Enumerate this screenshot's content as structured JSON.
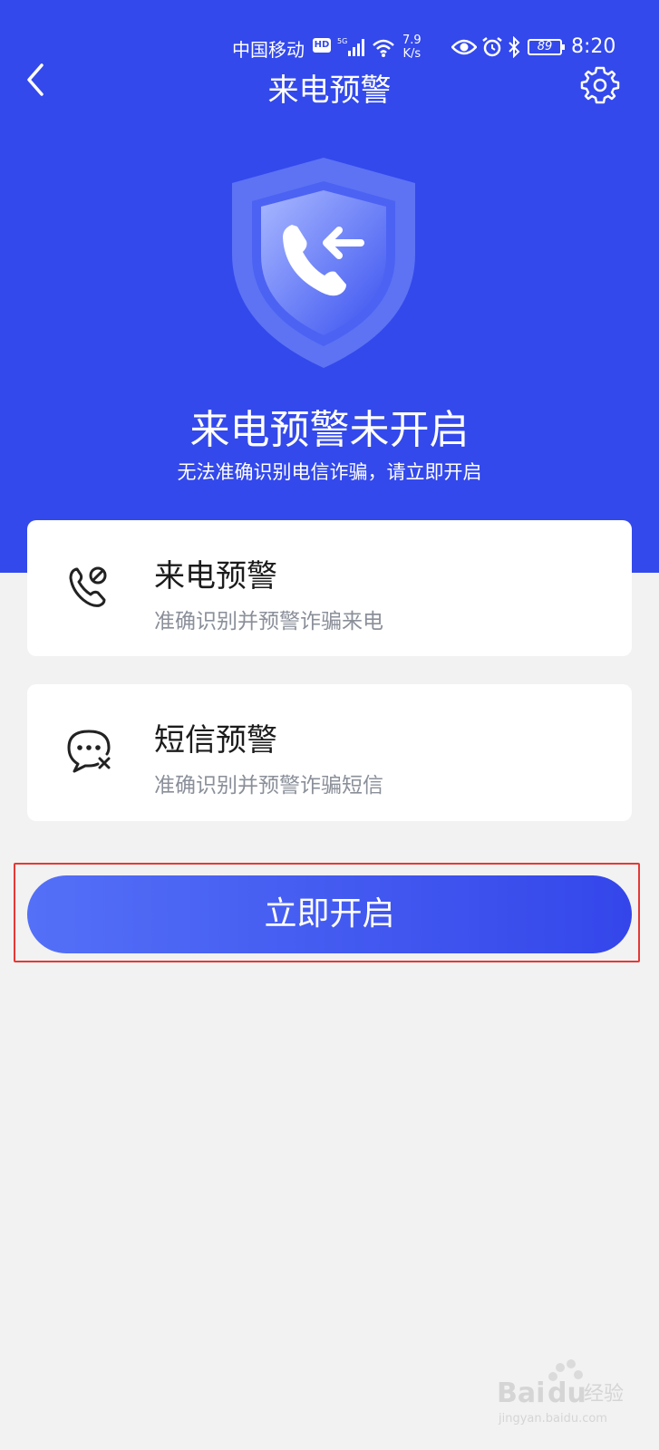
{
  "status_bar": {
    "carrier": "中国移动",
    "hd_badge": "HD",
    "speed_value": "7.9",
    "speed_unit": "K/s",
    "battery": "89",
    "time": "8:20"
  },
  "header": {
    "title": "来电预警",
    "back_icon": "chevron-left-icon",
    "settings_icon": "gear-icon"
  },
  "hero": {
    "icon": "shield-phone-icon",
    "status_title": "来电预警未开启",
    "status_subtitle": "无法准确识别电信诈骗，请立即开启"
  },
  "features": [
    {
      "title": "来电预警",
      "description": "准确识别并预警诈骗来电",
      "icon": "phone-block-icon"
    },
    {
      "title": "短信预警",
      "description": "准确识别并预警诈骗短信",
      "icon": "message-block-icon"
    }
  ],
  "action": {
    "enable_label": "立即开启"
  },
  "watermark": "Baidu经验 jingyan.baidu.com",
  "colors": {
    "primary": "#3349ec",
    "background": "#f2f2f2",
    "highlight": "#e53935"
  }
}
